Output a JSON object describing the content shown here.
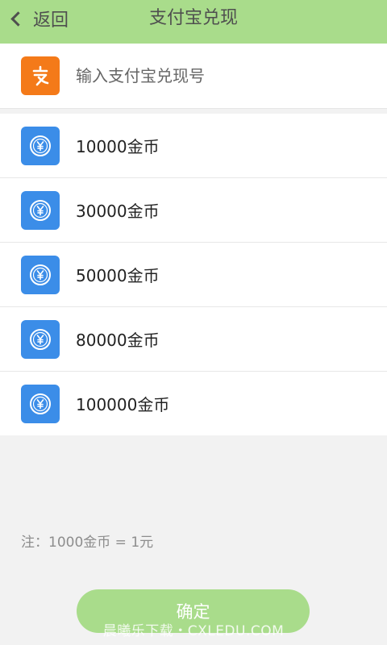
{
  "header": {
    "back_label": "返回",
    "title": "支付宝兑现"
  },
  "account": {
    "icon": "alipay-icon",
    "placeholder": "输入支付宝兑现号",
    "value": ""
  },
  "options": [
    {
      "label": "10000金币",
      "icon": "coin-icon"
    },
    {
      "label": "30000金币",
      "icon": "coin-icon"
    },
    {
      "label": "50000金币",
      "icon": "coin-icon"
    },
    {
      "label": "80000金币",
      "icon": "coin-icon"
    },
    {
      "label": "100000金币",
      "icon": "coin-icon"
    }
  ],
  "note": "注：1000金币 = 1元",
  "confirm_label": "确定",
  "watermark": "晨曦乐下载・CXLEDU.COM",
  "colors": {
    "header_bg": "#a9dc8b",
    "alipay_orange": "#f47a19",
    "coin_blue": "#3b8de8",
    "button_bg": "#a9dc8b"
  }
}
